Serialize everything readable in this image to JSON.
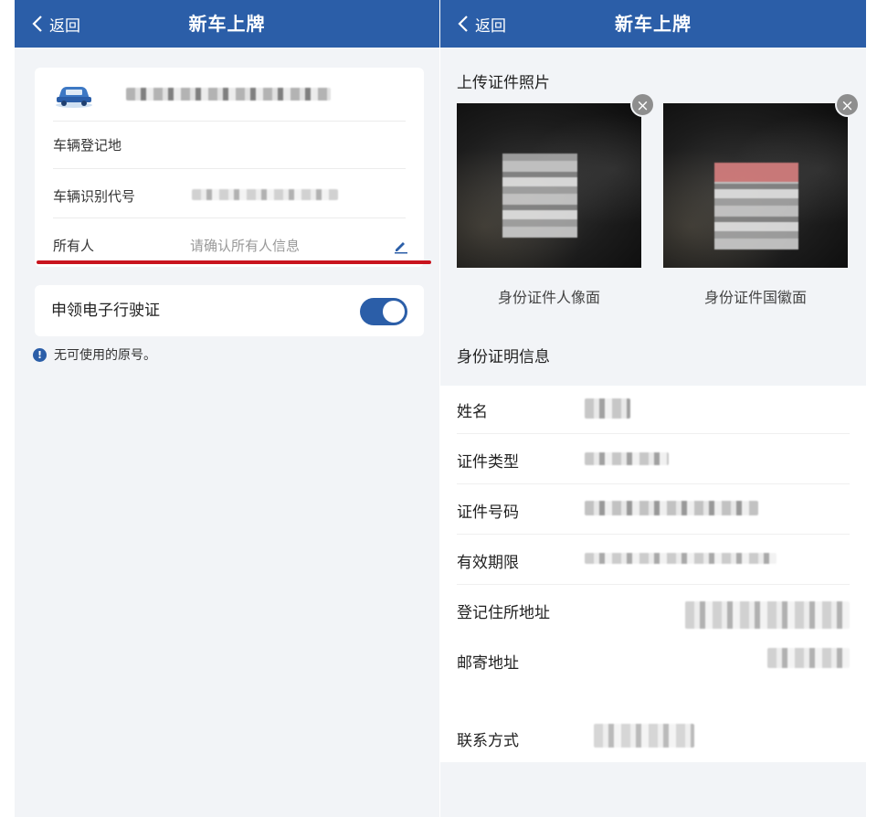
{
  "left": {
    "nav": {
      "back_label": "返回",
      "title": "新车上牌"
    },
    "vehicle": {
      "reg_place_label": "车辆登记地",
      "vin_label": "车辆识别代号",
      "owner_label": "所有人",
      "owner_placeholder": "请确认所有人信息"
    },
    "e_license": {
      "label": "申领电子行驶证",
      "enabled": true
    },
    "info": {
      "icon": "info-icon",
      "text": "无可使用的原号。"
    },
    "colors": {
      "nav": "#2b5ea8",
      "highlight_line": "#c8141e"
    }
  },
  "right": {
    "nav": {
      "back_label": "返回",
      "title": "新车上牌"
    },
    "upload_section_title": "上传证件照片",
    "photos": [
      {
        "caption": "身份证件人像面"
      },
      {
        "caption": "身份证件国徽面"
      }
    ],
    "id_section_title": "身份证明信息",
    "fields": [
      {
        "label": "姓名"
      },
      {
        "label": "证件类型"
      },
      {
        "label": "证件号码"
      },
      {
        "label": "有效期限"
      },
      {
        "label": "登记住所地址"
      },
      {
        "label": "邮寄地址"
      },
      {
        "label": "联系方式"
      }
    ]
  }
}
